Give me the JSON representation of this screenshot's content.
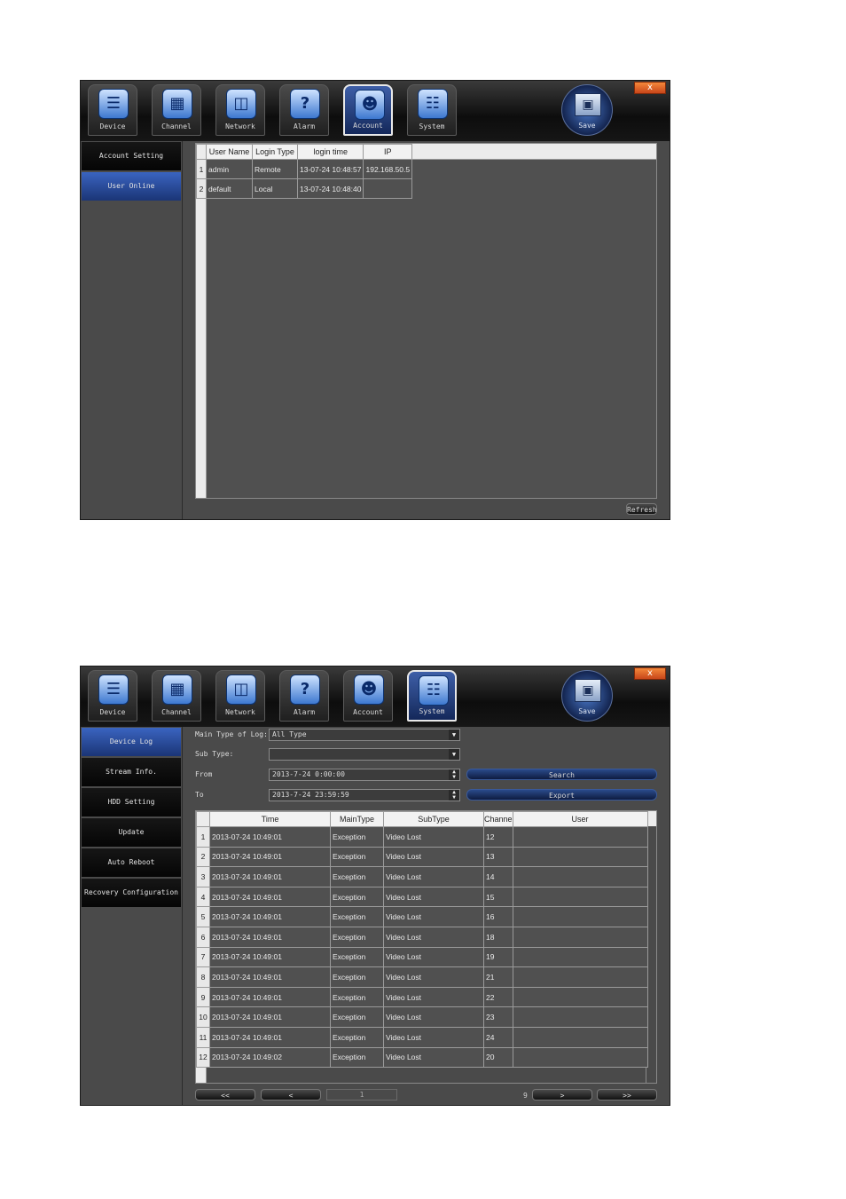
{
  "toolbar": {
    "close": "x",
    "buttons": [
      "Device",
      "Channel",
      "Network",
      "Alarm",
      "Account",
      "System"
    ],
    "save": "Save"
  },
  "window1": {
    "sidebar": [
      "Account Setting",
      "User Online"
    ],
    "table": {
      "headers": [
        "User Name",
        "Login Type",
        "login time",
        "IP"
      ],
      "rows": [
        [
          "1",
          "admin",
          "Remote",
          "13-07-24 10:48:57",
          "192.168.50.5"
        ],
        [
          "2",
          "default",
          "Local",
          "13-07-24 10:48:40",
          ""
        ]
      ]
    },
    "refresh": "Refresh"
  },
  "window2": {
    "sidebar": [
      "Device Log",
      "Stream Info.",
      "HDD Setting",
      "Update",
      "Auto Reboot",
      "Recovery Configuration"
    ],
    "filters": {
      "main_type_label": "Main Type of Log:",
      "main_type_value": "All Type",
      "sub_type_label": "Sub Type:",
      "sub_type_value": "",
      "from_label": "From",
      "from_value": "2013-7-24 0:00:00",
      "to_label": "To",
      "to_value": "2013-7-24 23:59:59",
      "search": "Search",
      "export": "Export"
    },
    "table": {
      "headers": [
        "Time",
        "MainType",
        "SubType",
        "Channe",
        "User"
      ],
      "rows": [
        [
          "1",
          "2013-07-24 10:49:01",
          "Exception",
          "Video Lost",
          "12",
          ""
        ],
        [
          "2",
          "2013-07-24 10:49:01",
          "Exception",
          "Video Lost",
          "13",
          ""
        ],
        [
          "3",
          "2013-07-24 10:49:01",
          "Exception",
          "Video Lost",
          "14",
          ""
        ],
        [
          "4",
          "2013-07-24 10:49:01",
          "Exception",
          "Video Lost",
          "15",
          ""
        ],
        [
          "5",
          "2013-07-24 10:49:01",
          "Exception",
          "Video Lost",
          "16",
          ""
        ],
        [
          "6",
          "2013-07-24 10:49:01",
          "Exception",
          "Video Lost",
          "18",
          ""
        ],
        [
          "7",
          "2013-07-24 10:49:01",
          "Exception",
          "Video Lost",
          "19",
          ""
        ],
        [
          "8",
          "2013-07-24 10:49:01",
          "Exception",
          "Video Lost",
          "21",
          ""
        ],
        [
          "9",
          "2013-07-24 10:49:01",
          "Exception",
          "Video Lost",
          "22",
          ""
        ],
        [
          "10",
          "2013-07-24 10:49:01",
          "Exception",
          "Video Lost",
          "23",
          ""
        ],
        [
          "11",
          "2013-07-24 10:49:01",
          "Exception",
          "Video Lost",
          "24",
          ""
        ],
        [
          "12",
          "2013-07-24 10:49:02",
          "Exception",
          "Video Lost",
          "20",
          ""
        ]
      ]
    },
    "pager": {
      "first": "<<",
      "prev": "<",
      "current_page": "1",
      "total_pages": "9",
      "next": ">",
      "last": ">>"
    }
  }
}
